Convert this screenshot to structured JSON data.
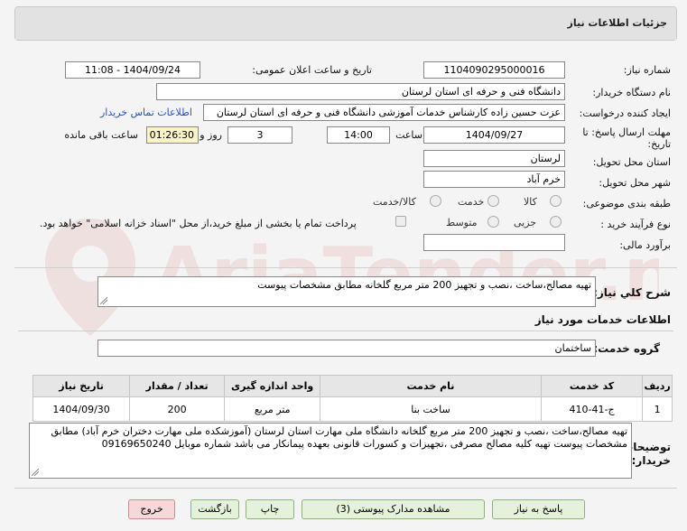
{
  "panel": {
    "title": "جزئیات اطلاعات نیاز"
  },
  "form": {
    "need_number_label": "شماره نیاز:",
    "need_number": "1104090295000016",
    "announce_label": "تاریخ و ساعت اعلان عمومی:",
    "announce_value": "1404/09/24 - 11:08",
    "buyer_org_label": "نام دستگاه خریدار:",
    "buyer_org": "دانشگاه فنی و حرفه ای استان لرستان",
    "creator_label": "ایجاد کننده درخواست:",
    "creator": "عزت حسین زاده کارشناس خدمات آموزشی دانشگاه فنی و حرفه ای استان لرستان",
    "contact_link": "اطلاعات تماس خریدار",
    "deadline_label_1": "مهلت ارسال پاسخ: تا",
    "deadline_label_2": "تاریخ:",
    "deadline_date": "1404/09/27",
    "hour_label": "ساعت",
    "deadline_hour": "14:00",
    "days": "3",
    "days_label": "روز و",
    "remaining": "01:26:30",
    "remaining_label": "ساعت باقی مانده",
    "province_label": "استان محل تحویل:",
    "province": "لرستان",
    "city_label": "شهر محل تحویل:",
    "city": "خرم آباد",
    "category_label": "طبقه بندی موضوعی:",
    "category_options": [
      "کالا",
      "خدمت",
      "کالا/خدمت"
    ],
    "process_label": "نوع فرآیند خرید :",
    "process_options": [
      "جزیی",
      "متوسط"
    ],
    "payment_note": "پرداخت تمام یا بخشی از مبلغ خرید،از محل \"اسناد خزانه اسلامی\" خواهد بود.",
    "estimate_label": "برآورد مالی:",
    "estimate": ""
  },
  "summary": {
    "label": "شرح کلي نياز:",
    "text": "تهیه مصالح،ساخت ،نصب و تجهیز 200 متر مربع گلخانه مطابق مشخصات پیوست"
  },
  "services": {
    "section_title": "اطلاعات خدمات مورد نیاز",
    "group_label": "گروه خدمت:",
    "group_value": "ساختمان",
    "columns": [
      "ردیف",
      "کد خدمت",
      "نام خدمت",
      "واحد اندازه گیری",
      "تعداد / مقدار",
      "تاریخ نیاز"
    ],
    "rows": [
      [
        "1",
        "ج-41-410",
        "ساخت بنا",
        "متر مربع",
        "200",
        "1404/09/30"
      ]
    ]
  },
  "buyer_notes": {
    "label_1": "توضیحات",
    "label_2": "خریدار:",
    "text": "تهیه مصالح،ساخت ،نصب و تجهیز 200 متر مربع گلخانه دانشگاه ملی مهارت استان لرستان (آموزشکده ملی مهارت دختران خرم آباد) مطابق مشخصات پیوست تهیه کلیه مصالح مصرفی ،تجهیزات و کسورات قانونی بعهده پیمانکار می باشد شماره موبایل 09169650240"
  },
  "buttons": {
    "reply": "پاسخ به نیاز",
    "attachments": "مشاهده مدارک پیوستی (3)",
    "print": "چاپ",
    "back": "بازگشت",
    "exit": "خروج"
  },
  "colors": {
    "accent_green": "#e4f2dc",
    "exit_pink": "#f7d8d8",
    "link_blue": "#1a56c9",
    "remaining_yellow": "#fbf3c8"
  }
}
